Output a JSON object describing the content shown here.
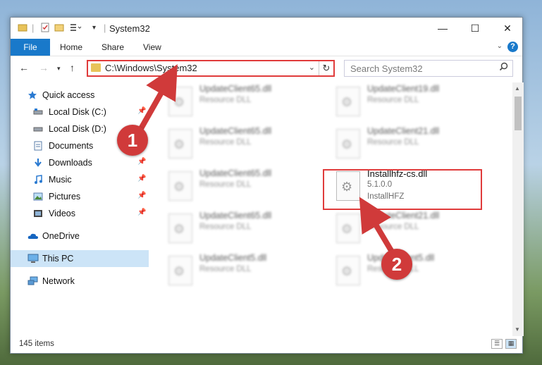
{
  "window": {
    "title": "System32",
    "controls": {
      "minimize": "—",
      "maximize": "☐",
      "close": "✕"
    }
  },
  "ribbon": {
    "tabs": [
      "File",
      "Home",
      "Share",
      "View"
    ],
    "help": "?"
  },
  "address_bar": {
    "path": "C:\\Windows\\System32"
  },
  "search": {
    "placeholder": "Search System32"
  },
  "sidebar": {
    "items": [
      {
        "label": "Quick access",
        "icon": "star-icon",
        "pinned": false
      },
      {
        "label": "Local Disk (C:)",
        "icon": "drive-icon",
        "pinned": true
      },
      {
        "label": "Local Disk (D:)",
        "icon": "drive-icon",
        "pinned": false
      },
      {
        "label": "Documents",
        "icon": "documents-icon",
        "pinned": true
      },
      {
        "label": "Downloads",
        "icon": "download-icon",
        "pinned": true
      },
      {
        "label": "Music",
        "icon": "music-icon",
        "pinned": true
      },
      {
        "label": "Pictures",
        "icon": "pictures-icon",
        "pinned": true
      },
      {
        "label": "Videos",
        "icon": "videos-icon",
        "pinned": true
      },
      {
        "label": "OneDrive",
        "icon": "cloud-icon",
        "pinned": false
      },
      {
        "label": "This PC",
        "icon": "computer-icon",
        "pinned": false,
        "selected": true
      },
      {
        "label": "Network",
        "icon": "network-icon",
        "pinned": false
      }
    ]
  },
  "files": [
    {
      "name": "UpdateClient65.dll",
      "type": "Resource DLL"
    },
    {
      "name": "UpdateClient19.dll",
      "type": "Resource DLL"
    },
    {
      "name": "UpdateClient65.dll",
      "type": "Resource DLL"
    },
    {
      "name": "UpdateClient21.dll",
      "type": "Resource DLL"
    },
    {
      "name": "UpdateClient65.dll",
      "type": "Resource DLL"
    },
    {
      "name": "Installhfz-cs.dll",
      "type": "5.1.0.0",
      "extra": "InstallHFZ",
      "highlighted": true
    },
    {
      "name": "UpdateClient65.dll",
      "type": "Resource DLL"
    },
    {
      "name": "UpdateClient21.dll",
      "type": "Resource DLL"
    },
    {
      "name": "UpdateClient5.dll",
      "type": "Resource DLL"
    },
    {
      "name": "UpdateClient5.dll",
      "type": "Resource DLL"
    }
  ],
  "status": {
    "item_count": "145 items"
  },
  "callouts": [
    "1",
    "2"
  ],
  "colors": {
    "accent": "#1979ca",
    "highlight": "#e03b3b",
    "callout": "#d03a3a",
    "selection": "#cce4f7"
  }
}
